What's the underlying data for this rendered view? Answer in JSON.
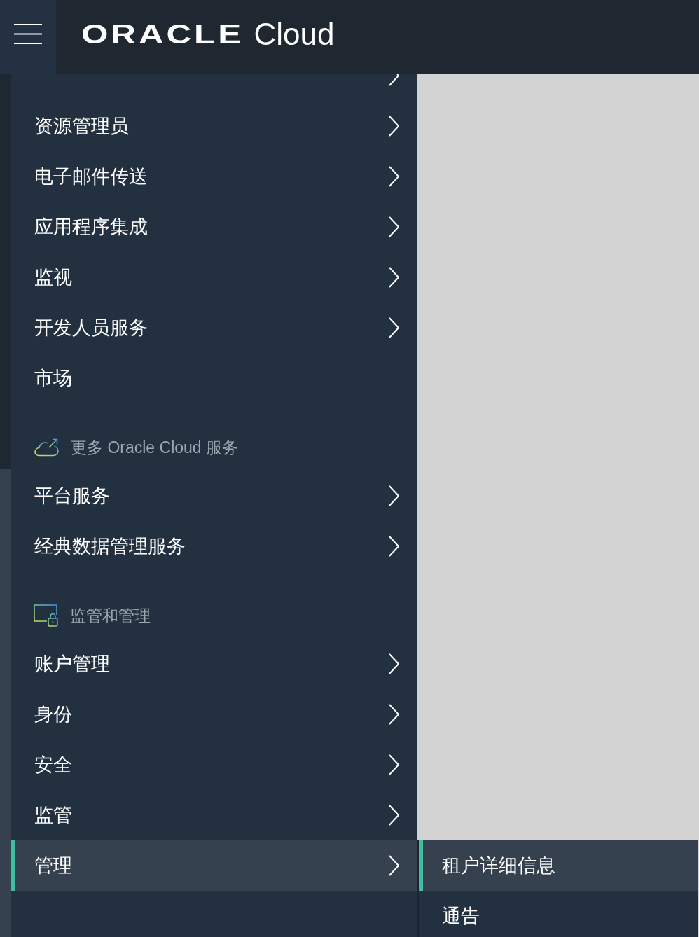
{
  "header": {
    "logo": {
      "brand": "ORACLE",
      "product": "Cloud"
    }
  },
  "menu": {
    "sections": [
      {
        "items": [
          {
            "has_submenu": true,
            "selected": false
          },
          {
            "label": "资源管理员",
            "has_submenu": true,
            "selected": false
          },
          {
            "label": "电子邮件传送",
            "has_submenu": true,
            "selected": false
          },
          {
            "label": "应用程序集成",
            "has_submenu": true,
            "selected": false
          },
          {
            "label": "监视",
            "has_submenu": true,
            "selected": false
          },
          {
            "label": "开发人员服务",
            "has_submenu": true,
            "selected": false
          },
          {
            "label": "市场",
            "has_submenu": false,
            "selected": false
          }
        ]
      },
      {
        "heading": "更多 Oracle Cloud 服务",
        "items": [
          {
            "label": "平台服务",
            "has_submenu": true,
            "selected": false
          },
          {
            "label": "经典数据管理服务",
            "has_submenu": true,
            "selected": false
          }
        ]
      },
      {
        "heading": "监管和管理",
        "items": [
          {
            "label": "账户管理",
            "has_submenu": true,
            "selected": false
          },
          {
            "label": "身份",
            "has_submenu": true,
            "selected": false
          },
          {
            "label": "安全",
            "has_submenu": true,
            "selected": false
          },
          {
            "label": "监管",
            "has_submenu": true,
            "selected": false
          },
          {
            "label": "管理",
            "has_submenu": true,
            "selected": true
          }
        ]
      }
    ]
  },
  "submenu": {
    "items": [
      {
        "label": "租户详细信息",
        "selected": true
      },
      {
        "label": "通告",
        "selected": false
      }
    ]
  }
}
